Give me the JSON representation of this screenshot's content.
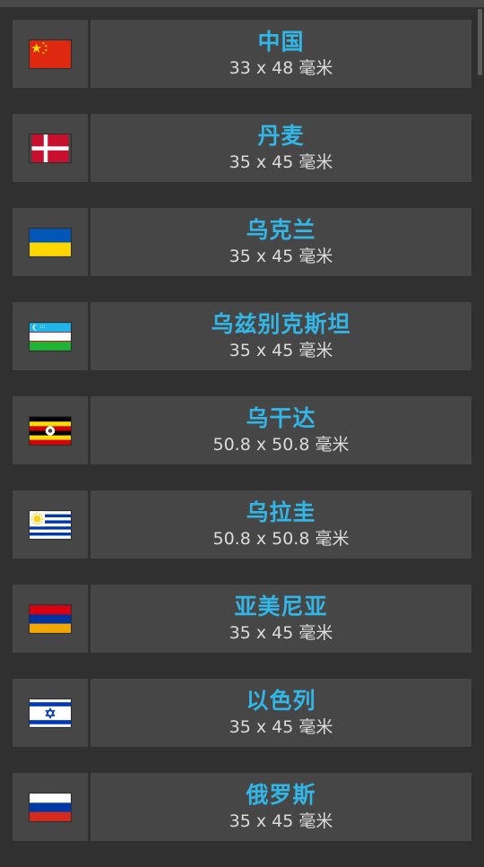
{
  "items": [
    {
      "name": "中国",
      "size": "33 x 48 毫米",
      "flag": "china-flag-icon"
    },
    {
      "name": "丹麦",
      "size": "35 x 45 毫米",
      "flag": "denmark-flag-icon"
    },
    {
      "name": "乌克兰",
      "size": "35 x 45 毫米",
      "flag": "ukraine-flag-icon"
    },
    {
      "name": "乌兹别克斯坦",
      "size": "35 x 45 毫米",
      "flag": "uzbekistan-flag-icon"
    },
    {
      "name": "乌干达",
      "size": "50.8 x 50.8 毫米",
      "flag": "uganda-flag-icon"
    },
    {
      "name": "乌拉圭",
      "size": "50.8 x 50.8 毫米",
      "flag": "uruguay-flag-icon"
    },
    {
      "name": "亚美尼亚",
      "size": "35 x 45 毫米",
      "flag": "armenia-flag-icon"
    },
    {
      "name": "以色列",
      "size": "35 x 45 毫米",
      "flag": "israel-flag-icon"
    },
    {
      "name": "俄罗斯",
      "size": "35 x 45 毫米",
      "flag": "russia-flag-icon"
    }
  ],
  "colors": {
    "accent": "#33b5e5",
    "background": "#303030",
    "cell": "#464646"
  }
}
